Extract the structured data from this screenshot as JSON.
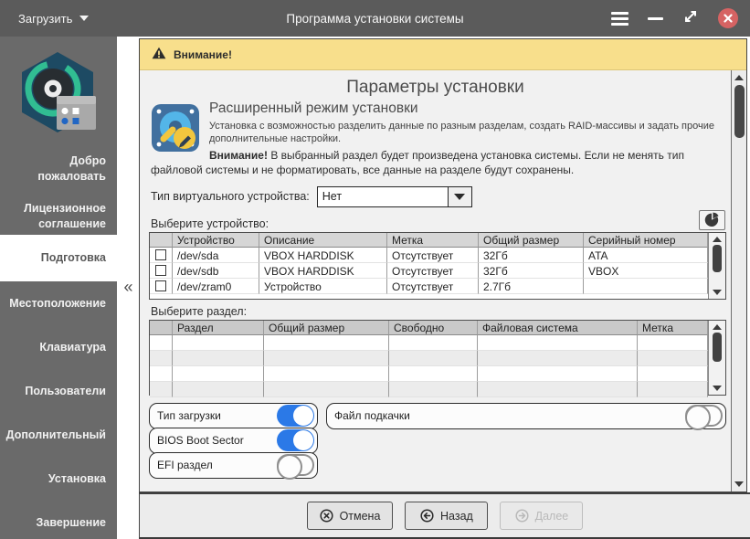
{
  "titlebar": {
    "load_button": "Загрузить",
    "title": "Программа установки системы"
  },
  "sidebar": {
    "collapse_glyph": "«",
    "items": [
      {
        "label": "Добро пожаловать",
        "active": false
      },
      {
        "label": "Лицензионное соглашение",
        "active": false
      },
      {
        "label": "Подготовка",
        "active": true
      },
      {
        "label": "Местоположение",
        "active": false
      },
      {
        "label": "Клавиатура",
        "active": false
      },
      {
        "label": "Пользователи",
        "active": false
      },
      {
        "label": "Дополнительный",
        "active": false
      },
      {
        "label": "Установка",
        "active": false
      },
      {
        "label": "Завершение",
        "active": false
      }
    ]
  },
  "banner": {
    "text": "Внимание!"
  },
  "page": {
    "heading": "Параметры установки"
  },
  "mode": {
    "title": "Расширенный режим установки",
    "description": "Установка с возможностью разделить данные по разным разделам, создать RAID-массивы и задать прочие дополнительные настройки.",
    "warning_bold": "Внимание!",
    "warning_rest": " В выбранный раздел будет произведена установка системы. Если не менять тип файловой системы и не форматировать, все данные на разделе будут сохранены."
  },
  "vdev": {
    "label": "Тип виртуального устройства:",
    "value": "Нет"
  },
  "device_section": {
    "label": "Выберите устройство:",
    "columns": {
      "device": "Устройство",
      "description": "Описание",
      "mark": "Метка",
      "size": "Общий размер",
      "serial": "Серийный номер"
    },
    "rows": [
      {
        "device": "/dev/sda",
        "description": "VBOX HARDDISK",
        "mark": "Отсутствует",
        "size": "32Гб",
        "serial": "ATA"
      },
      {
        "device": "/dev/sdb",
        "description": "VBOX HARDDISK",
        "mark": "Отсутствует",
        "size": "32Гб",
        "serial": "VBOX"
      },
      {
        "device": "/dev/zram0",
        "description": "Устройство",
        "mark": "Отсутствует",
        "size": "2.7Гб",
        "serial": ""
      }
    ]
  },
  "partition_section": {
    "label": "Выберите раздел:",
    "columns": {
      "partition": "Раздел",
      "size": "Общий размер",
      "free": "Свободно",
      "fs": "Файловая система",
      "mark": "Метка"
    }
  },
  "toggles": {
    "boot_type": {
      "label": "Тип загрузки",
      "on": true
    },
    "bios_boot": {
      "label": "BIOS Boot Sector",
      "on": true
    },
    "efi": {
      "label": "EFI раздел",
      "on": false
    },
    "swap_file": {
      "label": "Файл подкачки",
      "on": false
    }
  },
  "footer": {
    "cancel": "Отмена",
    "back": "Назад",
    "next": "Далее"
  },
  "colors": {
    "titlebar": "#5b5b5b",
    "sidebar": "#6a6a6a",
    "warning_banner": "#f8df8c",
    "accent_toggle": "#2b79e7",
    "close_button": "#d66363"
  }
}
